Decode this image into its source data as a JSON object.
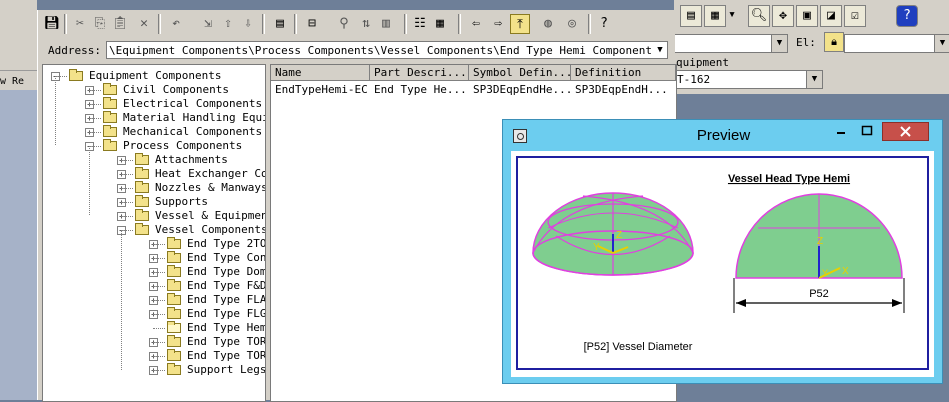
{
  "background_left": {
    "text": "w Re"
  },
  "background_right": {
    "toolbar_icons": [
      "copy-range-icon",
      "dropdown-arrow-icon",
      "zoom-icon",
      "pan-icon",
      "fit-icon",
      "view-icon",
      "check-icon",
      "help-icon"
    ],
    "label_el": "El:",
    "label_equipment": "Equipment",
    "combo_value": "T-162",
    "label_equipment_char": "quipment"
  },
  "dialog": {
    "toolbar_icons": [
      "save-icon",
      "cut-icon",
      "copy-icon",
      "paste-icon",
      "delete-icon",
      "undo-icon",
      "import-icon",
      "export-icon",
      "export2-icon",
      "properties-icon",
      "tree-view-icon",
      "filter-icon",
      "sort-icon",
      "column-icon",
      "details-icon",
      "list-icon",
      "back-icon",
      "forward-icon",
      "up-folder-icon",
      "tool1-icon",
      "tool2-icon",
      "help-icon"
    ],
    "address_label": "Address:",
    "address_value": "\\Equipment Components\\Process Components\\Vessel Components\\End Type Hemi Component",
    "tree": [
      {
        "label": "Equipment Components",
        "level": 0,
        "expander": "-"
      },
      {
        "label": "Civil Components",
        "level": 1,
        "expander": "+"
      },
      {
        "label": "Electrical Components",
        "level": 1,
        "expander": "+"
      },
      {
        "label": "Material Handling Equip",
        "level": 1,
        "expander": "+"
      },
      {
        "label": "Mechanical Components",
        "level": 1,
        "expander": "+"
      },
      {
        "label": "Process Components",
        "level": 1,
        "expander": "-"
      },
      {
        "label": "Attachments",
        "level": 2,
        "expander": "+"
      },
      {
        "label": "Heat Exchanger Co",
        "level": 2,
        "expander": "+"
      },
      {
        "label": "Nozzles & Manways",
        "level": 2,
        "expander": "+"
      },
      {
        "label": "Supports",
        "level": 2,
        "expander": "+"
      },
      {
        "label": "Vessel & Equipmen",
        "level": 2,
        "expander": "+"
      },
      {
        "label": "Vessel Components",
        "level": 2,
        "expander": "-"
      },
      {
        "label": "End Type 2TO",
        "level": 3,
        "expander": "+"
      },
      {
        "label": "End Type Con",
        "level": 3,
        "expander": "+"
      },
      {
        "label": "End Type Dom",
        "level": 3,
        "expander": "+"
      },
      {
        "label": "End Type F&D",
        "level": 3,
        "expander": "+"
      },
      {
        "label": "End Type FLA",
        "level": 3,
        "expander": "+"
      },
      {
        "label": "End Type FLG",
        "level": 3,
        "expander": "+"
      },
      {
        "label": "End Type Hem",
        "level": 3,
        "expander": "",
        "open": true
      },
      {
        "label": "End Type TOR",
        "level": 3,
        "expander": "+"
      },
      {
        "label": "End Type TOR",
        "level": 3,
        "expander": "+"
      },
      {
        "label": "Support Legs",
        "level": 3,
        "expander": "+"
      }
    ],
    "list_columns": [
      "Name",
      "Part Descri...",
      "Symbol Defin...",
      "Definition"
    ],
    "list_rows": [
      [
        "EndTypeHemi-EC",
        "End Type He...",
        "SP3DEqpEndHe...",
        "SP3DEqpEndH..."
      ]
    ]
  },
  "preview": {
    "title": "Preview",
    "drawing_title": "Vessel Head Type Hemi",
    "dimension_label": "P52",
    "caption": "[P52] Vessel Diameter",
    "axis_x": "X",
    "axis_y": "Y",
    "axis_z": "Z",
    "colors": {
      "dome_fill": "#7fce8f",
      "edge": "#e040e0",
      "frame": "#1f1fa0",
      "axis_z": "#2222cc",
      "axis_x": "#e8d000"
    }
  }
}
